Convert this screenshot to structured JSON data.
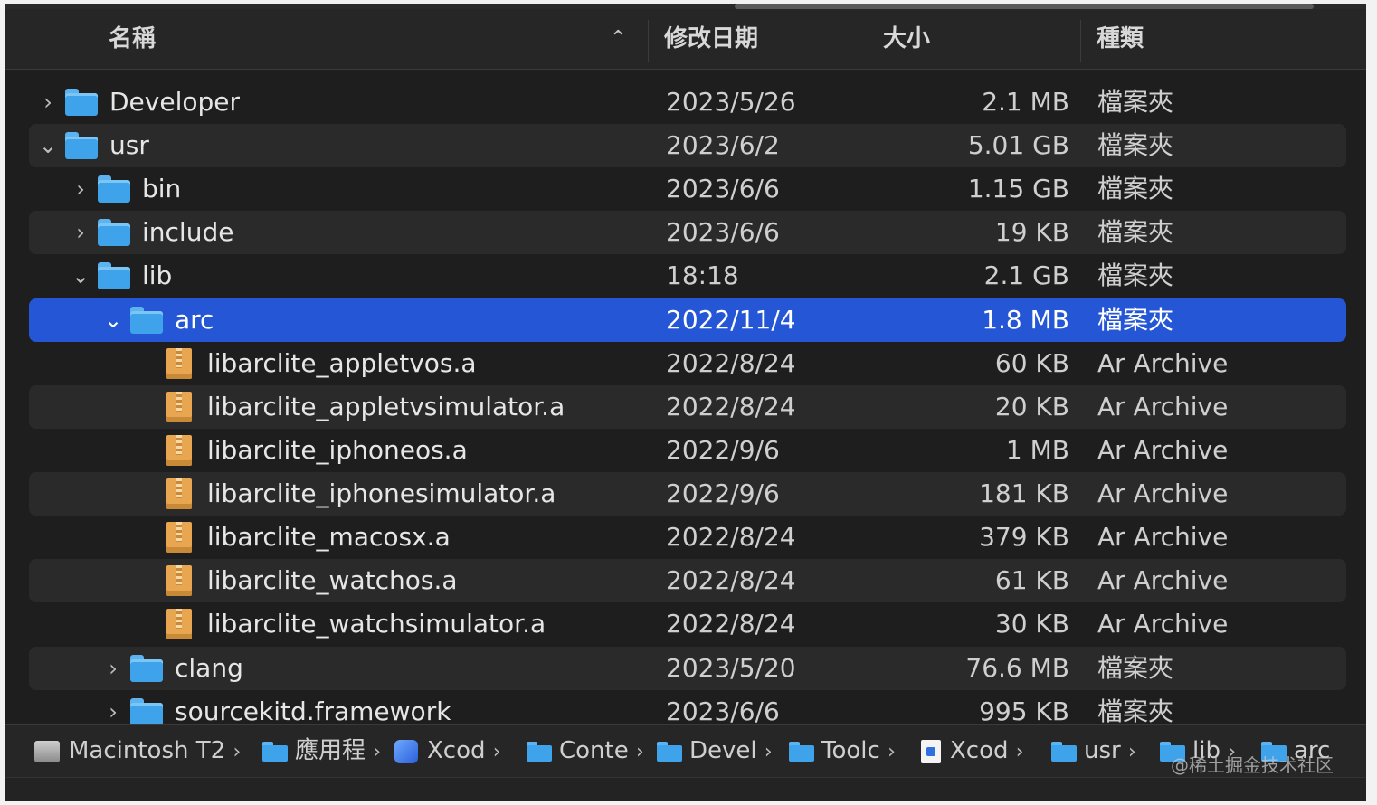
{
  "header": {
    "name": "名稱",
    "date": "修改日期",
    "size": "大小",
    "kind": "種類",
    "sort_icon": "chevron-up-icon"
  },
  "rows": [
    {
      "name": "Developer",
      "date": "2023/5/26",
      "size": "2.1 MB",
      "kind": "檔案夾",
      "icon": "folder-icon",
      "expanded": false
    },
    {
      "name": "usr",
      "date": "2023/6/2",
      "size": "5.01 GB",
      "kind": "檔案夾",
      "icon": "folder-icon",
      "expanded": true
    },
    {
      "name": "bin",
      "date": "2023/6/6",
      "size": "1.15 GB",
      "kind": "檔案夾",
      "icon": "folder-icon",
      "expanded": false
    },
    {
      "name": "include",
      "date": "2023/6/6",
      "size": "19 KB",
      "kind": "檔案夾",
      "icon": "folder-icon",
      "expanded": false
    },
    {
      "name": "lib",
      "date": "18:18",
      "size": "2.1 GB",
      "kind": "檔案夾",
      "icon": "folder-icon",
      "expanded": true
    },
    {
      "name": "arc",
      "date": "2022/11/4",
      "size": "1.8 MB",
      "kind": "檔案夾",
      "icon": "folder-icon",
      "expanded": true,
      "selected": true
    },
    {
      "name": "libarclite_appletvos.a",
      "date": "2022/8/24",
      "size": "60 KB",
      "kind": "Ar Archive",
      "icon": "archive-icon"
    },
    {
      "name": "libarclite_appletvsimulator.a",
      "date": "2022/8/24",
      "size": "20 KB",
      "kind": "Ar Archive",
      "icon": "archive-icon"
    },
    {
      "name": "libarclite_iphoneos.a",
      "date": "2022/9/6",
      "size": "1 MB",
      "kind": "Ar Archive",
      "icon": "archive-icon"
    },
    {
      "name": "libarclite_iphonesimulator.a",
      "date": "2022/9/6",
      "size": "181 KB",
      "kind": "Ar Archive",
      "icon": "archive-icon"
    },
    {
      "name": "libarclite_macosx.a",
      "date": "2022/8/24",
      "size": "379 KB",
      "kind": "Ar Archive",
      "icon": "archive-icon"
    },
    {
      "name": "libarclite_watchos.a",
      "date": "2022/8/24",
      "size": "61 KB",
      "kind": "Ar Archive",
      "icon": "archive-icon"
    },
    {
      "name": "libarclite_watchsimulator.a",
      "date": "2022/8/24",
      "size": "30 KB",
      "kind": "Ar Archive",
      "icon": "archive-icon"
    },
    {
      "name": "clang",
      "date": "2023/5/20",
      "size": "76.6 MB",
      "kind": "檔案夾",
      "icon": "folder-icon",
      "expanded": false
    },
    {
      "name": "sourcekitd.framework",
      "date": "2023/6/6",
      "size": "995 KB",
      "kind": "檔案夾",
      "icon": "folder-icon",
      "expanded": false
    }
  ],
  "pathbar": {
    "items": [
      {
        "label": "Macintosh T2",
        "icon": "disk-icon"
      },
      {
        "label": "應用程",
        "icon": "applications-folder-icon"
      },
      {
        "label": "Xcod",
        "icon": "xcode-app-icon"
      },
      {
        "label": "Conte",
        "icon": "folder-icon"
      },
      {
        "label": "Devel",
        "icon": "folder-icon"
      },
      {
        "label": "Toolc",
        "icon": "folder-icon"
      },
      {
        "label": "Xcod",
        "icon": "document-icon"
      },
      {
        "label": "usr",
        "icon": "folder-icon"
      },
      {
        "label": "lib",
        "icon": "folder-icon"
      },
      {
        "label": "arc",
        "icon": "folder-icon"
      }
    ],
    "separator": "›"
  },
  "watermark": "@稀土掘金技术社区",
  "colors": {
    "background": "#1e1e1e",
    "selection": "#2456d6",
    "folder": "#3ea3ea",
    "archive": "#e9a650"
  }
}
